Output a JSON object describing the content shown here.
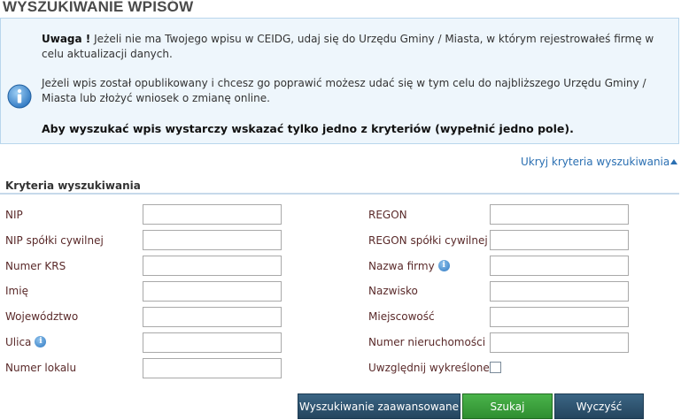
{
  "page_title": "WYSZUKIWANIE WPISÓW",
  "info": {
    "warning_bold": "Uwaga !",
    "warning_text": "Jeżeli nie ma Twojego wpisu w CEIDG, udaj się do Urzędu Gminy / Miasta, w którym rejestrowałeś firmę w celu aktualizacji danych.",
    "published_text": "Jeżeli wpis został opublikowany i chcesz go poprawić możesz udać się w tym celu do najbliższego Urzędu Gminy / Miasta lub złożyć wniosek o zmianę online.",
    "criteria_hint": "Aby wyszukać wpis wystarczy wskazać tylko jedno z kryteriów (wypełnić jedno pole)."
  },
  "toggle_link": "Ukryj kryteria wyszukiwania",
  "section_title": "Kryteria wyszukiwania",
  "fields_left": {
    "nip": "NIP",
    "nip_civil": "NIP spółki cywilnej",
    "krs": "Numer KRS",
    "first_name": "Imię",
    "voivodeship": "Województwo",
    "street": "Ulica",
    "unit_number": "Numer lokalu"
  },
  "fields_right": {
    "regon": "REGON",
    "regon_civil": "REGON spółki cywilnej",
    "company_name": "Nazwa firmy",
    "last_name": "Nazwisko",
    "city": "Miejscowość",
    "property_number": "Numer nieruchomości",
    "include_deleted": "Uwzględnij wykreślone"
  },
  "include_deleted_checked": false,
  "buttons": {
    "advanced": "Wyszukiwanie zaawansowane",
    "search": "Szukaj",
    "clear": "Wyczyść"
  },
  "help_icon_glyph": "i",
  "colors": {
    "info_bg": "#eef6fc",
    "link": "#2a6fb2",
    "search_button": "#3aa23c",
    "dark_button": "#2e5473"
  }
}
